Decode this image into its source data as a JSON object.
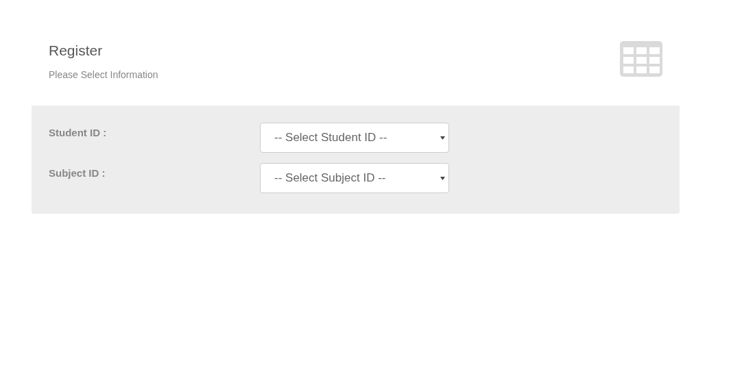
{
  "header": {
    "title": "Register",
    "subtitle": "Please Select Information"
  },
  "fields": [
    {
      "label": "Student ID :",
      "placeholder": "-- Select Student ID --"
    },
    {
      "label": "Subject ID :",
      "placeholder": "-- Select Subject ID --"
    }
  ]
}
